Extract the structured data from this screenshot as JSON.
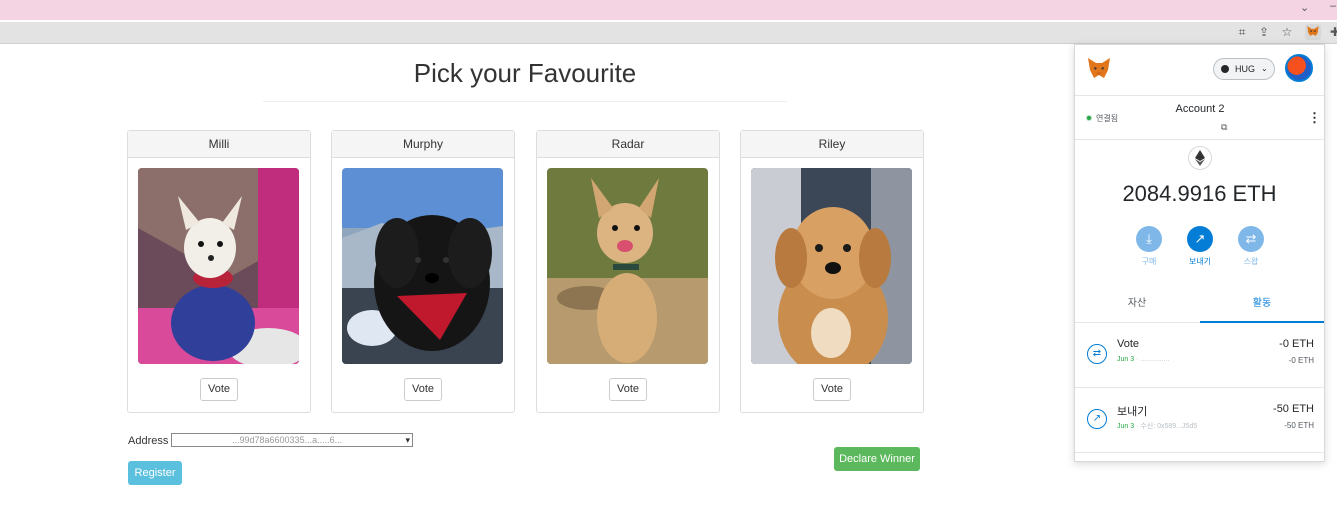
{
  "page": {
    "title": "Pick your Favourite",
    "vote_label": "Vote",
    "address_label": "Address :",
    "address_value": "...99d78a6600335...a.....6...",
    "register_label": "Register",
    "declare_winner_label": "Declare Winner"
  },
  "pets": [
    {
      "name": "Milli"
    },
    {
      "name": "Murphy"
    },
    {
      "name": "Radar"
    },
    {
      "name": "Riley"
    }
  ],
  "metamask": {
    "network": "HUG",
    "connected_label": "연결됨",
    "account_name": "Account 2",
    "balance": "2084.9916 ETH",
    "actions": [
      {
        "label": "구매",
        "icon": "download-icon",
        "color": "#7fb7e9"
      },
      {
        "label": "보내기",
        "icon": "send-arrow-icon",
        "color": "#037dd6"
      },
      {
        "label": "스왑",
        "icon": "swap-icon",
        "color": "#7fb7e9"
      }
    ],
    "tabs": [
      "자산",
      "활동"
    ],
    "active_tab": "활동",
    "transactions": [
      {
        "title": "Vote",
        "date": "Jun 3",
        "detail": "· ...............",
        "amount": "-0 ETH",
        "amount_sub": "-0 ETH",
        "icon": "swap-icon"
      },
      {
        "title": "보내기",
        "date": "Jun 3",
        "detail": "· 수신: 0x589...J5d5",
        "amount": "-50 ETH",
        "amount_sub": "-50 ETH",
        "icon": "send-arrow-icon"
      }
    ]
  },
  "colors": {
    "tab_strip": "#f4d3e3",
    "register": "#5bc0de",
    "declare_winner": "#5cb85c",
    "metamask_blue": "#037dd6"
  }
}
